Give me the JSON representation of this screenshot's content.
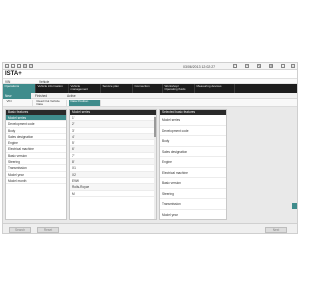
{
  "toolbar": {
    "icons": [
      "home-icon",
      "back-icon",
      "forward-icon",
      "list-icon",
      "print-icon"
    ],
    "datetime": "03/06/2013 12:02:27",
    "right_icons": [
      "ticket-icon",
      "help-icon",
      "wrench-icon",
      "settings-icon",
      "window-icon",
      "close-icon"
    ]
  },
  "app_title": "ISTA+",
  "vin_row": {
    "label": "VIN",
    "value": "Vehicle"
  },
  "main_nav": [
    "Operations",
    "Vehicle information",
    "Vehicle management",
    "Service plan",
    "Connection",
    "Workshop/ Operating fluids",
    "Measuring devices"
  ],
  "sub_nav": [
    "New",
    "Finished",
    "Active"
  ],
  "crumbs": [
    "VIN",
    "Read Out Vehicle Data",
    "Data Position"
  ],
  "basic_panel": {
    "header": "Basic features",
    "items": [
      "Model series",
      "Development code",
      "Body",
      "Sales designation",
      "Engine",
      "Electrical machine",
      "Basic version",
      "Steering",
      "Transmission",
      "Model year",
      "Model month"
    ]
  },
  "model_panel": {
    "header": "Model series",
    "items": [
      "1'",
      "2'",
      "3'",
      "4'",
      "5'",
      "6'",
      "7'",
      "8'",
      "X1",
      "X2",
      "E9W",
      "Rolls-Royce",
      "M"
    ]
  },
  "selected_panel": {
    "header": "Selected basic features",
    "items": [
      "Model series",
      "Development code",
      "Body",
      "Sales designation",
      "Engine",
      "Electrical machine",
      "Basic version",
      "Steering",
      "Transmission",
      "Model year"
    ]
  },
  "bottom": {
    "btn1": "Search",
    "btn2": "Reset",
    "btn3": "Next"
  }
}
